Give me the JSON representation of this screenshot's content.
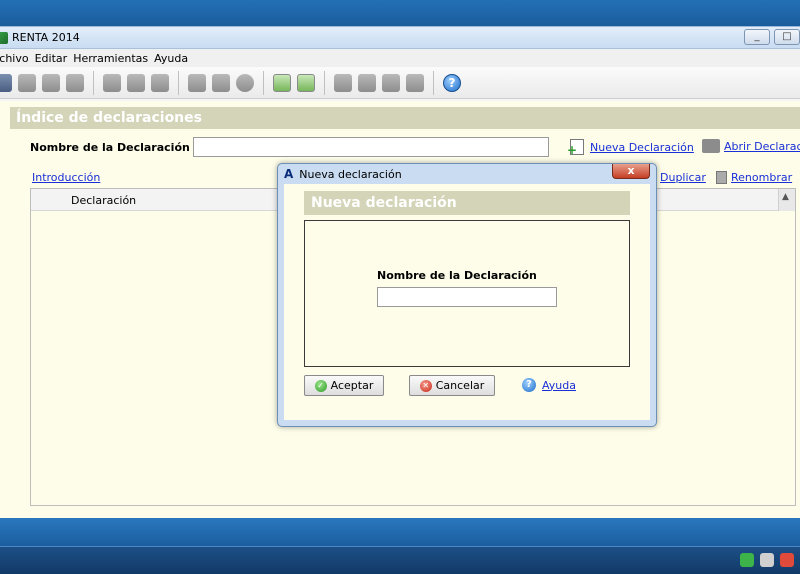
{
  "window": {
    "title": "RENTA 2014",
    "controls": {
      "minimize": "_",
      "maximize": "□"
    }
  },
  "menu": [
    "rchivo",
    "Editar",
    "Herramientas",
    "Ayuda"
  ],
  "toolbar": {
    "help_glyph": "?"
  },
  "main": {
    "section_title": "Índice de declaraciones",
    "name_label": "Nombre de la Declaración",
    "name_value": "",
    "new_link": "Nueva Declaración",
    "open_link": "Abrir Declaració",
    "intro_link": "Introducción",
    "duplicate_link": "Duplicar",
    "rename_link": "Renombrar",
    "table": {
      "columns": [
        "Declaración"
      ]
    }
  },
  "dialog": {
    "logo": "A",
    "title": "Nueva declaración",
    "close": "x",
    "header": "Nueva declaración",
    "name_label": "Nombre de la Declaración",
    "name_value": "",
    "accept": "Aceptar",
    "cancel": "Cancelar",
    "help": "Ayuda",
    "ok_glyph": "✓",
    "cancel_glyph": "✕",
    "help_glyph": "?"
  },
  "colors": {
    "section_bg": "#d4d4b8",
    "content_bg": "#fdfde9",
    "link": "#1a2fd6"
  }
}
